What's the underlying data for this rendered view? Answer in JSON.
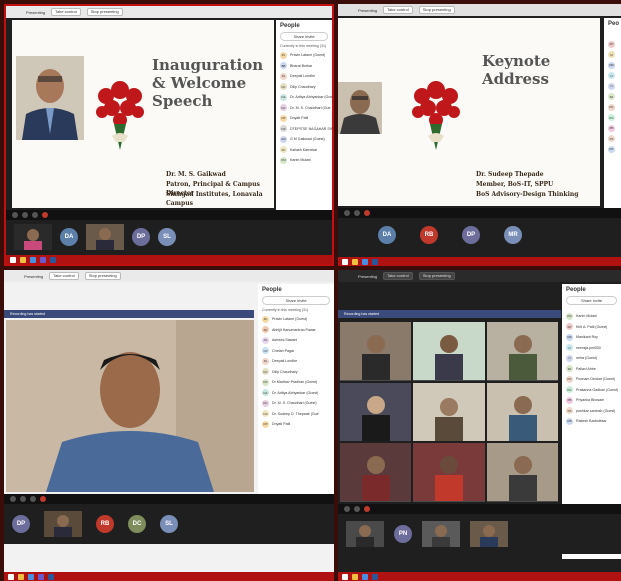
{
  "q1": {
    "toolbar": {
      "presenting": "Presenting",
      "take_control": "Take control",
      "stop": "Stop presenting"
    },
    "slide": {
      "title": "Inauguration & Welcome Speech",
      "name": "Dr. M. S. Gaikwad",
      "role": "Patron, Principal & Campus Director",
      "org": "Sinhgad Institutes, Lonavala Campus"
    },
    "people": {
      "title": "People",
      "invite": "Share invite",
      "section": "Currently in this meeting (31)",
      "list": [
        {
          "initials": "PL",
          "name": "Pravin Latane (Guest)",
          "color": "#f4d9a6"
        },
        {
          "initials": "BB",
          "name": "Bharat Borkar",
          "color": "#c9d7f0"
        },
        {
          "initials": "DL",
          "name": "Deepali Londhe",
          "color": "#f0d6c9"
        },
        {
          "initials": "DC",
          "name": "Dilip Chaudhary",
          "color": "#e6e0c2"
        },
        {
          "initials": "DA",
          "name": "Dr. Aditya Abhyankar (Gue",
          "color": "#c9e7e0"
        },
        {
          "initials": "DC",
          "name": "Dr. M. S. Chaudhari (Gue",
          "color": "#e7d0e0"
        },
        {
          "initials": "DP",
          "name": "Dnyati Patil",
          "color": "#f7d9a6"
        },
        {
          "initials": "DS",
          "name": "DTEPITSE NAGAHAR SINGH",
          "color": "#d9d9d9"
        },
        {
          "initials": "GM",
          "name": "G M Gaikwad (Guest)",
          "color": "#d0d6f0"
        },
        {
          "initials": "KK",
          "name": "Kailash Karnekar",
          "color": "#f0e6c2"
        },
        {
          "initials": "KM",
          "name": "Karim Mulani",
          "color": "#d6e6c9"
        }
      ]
    },
    "strip": {
      "circles": [
        {
          "label": "DA",
          "color": "#5b7fa8"
        },
        {
          "label": "DP",
          "color": "#6d6d9b"
        },
        {
          "label": "SL",
          "color": "#7a8fb8"
        }
      ]
    }
  },
  "q2": {
    "toolbar": {
      "presenting": "Presenting",
      "take_control": "Take control",
      "stop": "Stop presenting"
    },
    "slide": {
      "title": "Keynote Address",
      "name": "Dr. Sudeep Thepade",
      "role": "Member, BoS-IT, SPPU",
      "org": "BoS Advisory-Design Thinking"
    },
    "people": {
      "title": "Peo",
      "avatars": [
        {
          "initials": "KP",
          "color": "#f0c9c9"
        },
        {
          "initials": "M",
          "color": "#f0e0b8"
        },
        {
          "initials": "MR",
          "color": "#c9d7f0"
        },
        {
          "initials": "N",
          "color": "#c9e7f0"
        },
        {
          "initials": "N",
          "color": "#d0d6f0"
        },
        {
          "initials": "PA",
          "color": "#d9e6c9"
        },
        {
          "initials": "PD",
          "color": "#f0d6c9"
        },
        {
          "initials": "PG",
          "color": "#c9f0d9"
        },
        {
          "initials": "PB",
          "color": "#f0c9e0"
        },
        {
          "initials": "PS",
          "color": "#f0d9c9"
        },
        {
          "initials": "RP",
          "color": "#c9d9f0"
        }
      ]
    },
    "strip": {
      "circles": [
        {
          "label": "DA",
          "color": "#5b7fa8"
        },
        {
          "label": "RB",
          "color": "#c0392b"
        },
        {
          "label": "DP",
          "color": "#6d6d9b"
        },
        {
          "label": "MR",
          "color": "#7a8fb8"
        }
      ]
    }
  },
  "q3": {
    "toolbar": {
      "presenting": "Presenting",
      "take_control": "Take control",
      "stop": "Stop presenting"
    },
    "banner": "Recording has started",
    "people": {
      "title": "People",
      "invite": "Share invite",
      "section": "Currently in this meeting (31)",
      "list": [
        {
          "initials": "PL",
          "name": "Pravin Latane (Guest)",
          "color": "#f4d9a6"
        },
        {
          "initials": "AK",
          "name": "Abhijit Hanumantrao Pawar",
          "color": "#f0c9b0"
        },
        {
          "initials": "AS",
          "name": "Ashwini Sawant",
          "color": "#e6d6f0"
        },
        {
          "initials": "CP",
          "name": "Chetan Pagar",
          "color": "#c9e0f0"
        },
        {
          "initials": "DL",
          "name": "Deepali Londhe",
          "color": "#f0d6c9"
        },
        {
          "initials": "DC",
          "name": "Dilip Chaudhary",
          "color": "#e6e0c2"
        },
        {
          "initials": "DP",
          "name": "Dr Madhav Pradhan (Guest)",
          "color": "#d9e6c9"
        },
        {
          "initials": "DA",
          "name": "Dr. Aditya Abhyankar (Guest)",
          "color": "#c9e7e0"
        },
        {
          "initials": "DC",
          "name": "Dr. M. S. Chaudhari (Guest)",
          "color": "#e7d0e0"
        },
        {
          "initials": "DS",
          "name": "Dr. Sudeep D. Thepade (Gue",
          "color": "#f0e6c2"
        },
        {
          "initials": "DP",
          "name": "Dnyati Patil",
          "color": "#f7d9a6"
        }
      ]
    },
    "strip": {
      "circles": [
        {
          "label": "DP",
          "color": "#6d6d9b"
        },
        {
          "label": "RB",
          "color": "#c0392b"
        },
        {
          "label": "DC",
          "color": "#7f8c5b"
        },
        {
          "label": "SL",
          "color": "#7a8fb8"
        }
      ]
    }
  },
  "q4": {
    "toolbar": {
      "presenting": "Presenting",
      "take_control": "Take control",
      "stop": "Stop presenting"
    },
    "banner": "Recording has started",
    "people": {
      "title": "People",
      "invite": "Share invite",
      "list": [
        {
          "initials": "KM",
          "name": "Karim Mulani",
          "color": "#d6e6c9"
        },
        {
          "initials": "KP",
          "name": "Kirti A. Patil (Guest)",
          "color": "#f0c9c9"
        },
        {
          "initials": "MR",
          "name": "Manikant Roy",
          "color": "#c9d7f0"
        },
        {
          "initials": "N",
          "name": "neeraja.pml300",
          "color": "#c9e7f0"
        },
        {
          "initials": "N",
          "name": "neha (Guest)",
          "color": "#d0d6f0"
        },
        {
          "initials": "PA",
          "name": "Pallavi Ahire",
          "color": "#d9e6c9"
        },
        {
          "initials": "PD",
          "name": "Poonam Deokar (Guest)",
          "color": "#f0d6c9"
        },
        {
          "initials": "PG",
          "name": "Prasanna Gadkari (Guest)",
          "color": "#c9f0d9"
        },
        {
          "initials": "PB",
          "name": "Priyanka Bhosale",
          "color": "#f0c9e0"
        },
        {
          "initials": "PS",
          "name": "pushkar santosh (Guest)",
          "color": "#f0d9c9"
        },
        {
          "initials": "RB",
          "name": "Rakesh Badodekar",
          "color": "#c9d9f0"
        }
      ]
    },
    "strip": {
      "circles": [
        {
          "label": "PN",
          "color": "#6d6d9b"
        }
      ]
    }
  }
}
